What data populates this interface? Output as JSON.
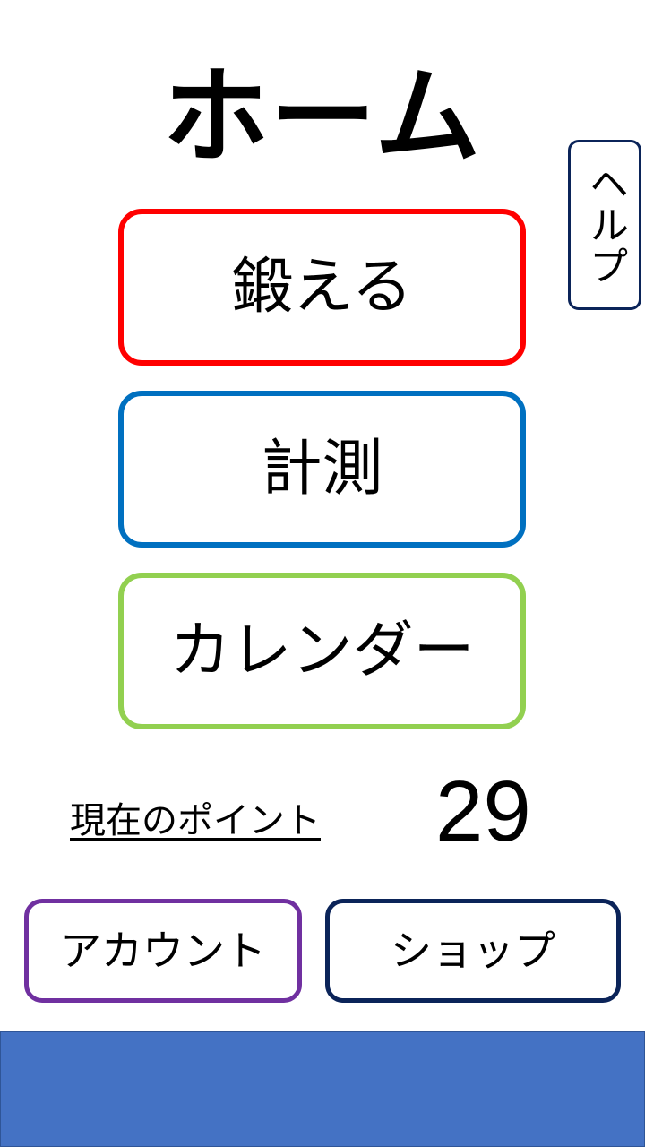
{
  "header": {
    "title": "ホーム"
  },
  "help_button": {
    "label": "ヘルプ",
    "border_color": "#0b2459"
  },
  "menu": {
    "train": {
      "label": "鍛える",
      "border_color": "#ff0000"
    },
    "measure": {
      "label": "計測",
      "border_color": "#0070c0"
    },
    "calendar": {
      "label": "カレンダー",
      "border_color": "#92d050"
    }
  },
  "points": {
    "label": "現在のポイント",
    "value": "29"
  },
  "footer_buttons": {
    "account": {
      "label": "アカウント",
      "border_color": "#7030a0"
    },
    "shop": {
      "label": "ショップ",
      "border_color": "#0b2459"
    }
  },
  "bottom_bar": {
    "color": "#4472c4"
  }
}
